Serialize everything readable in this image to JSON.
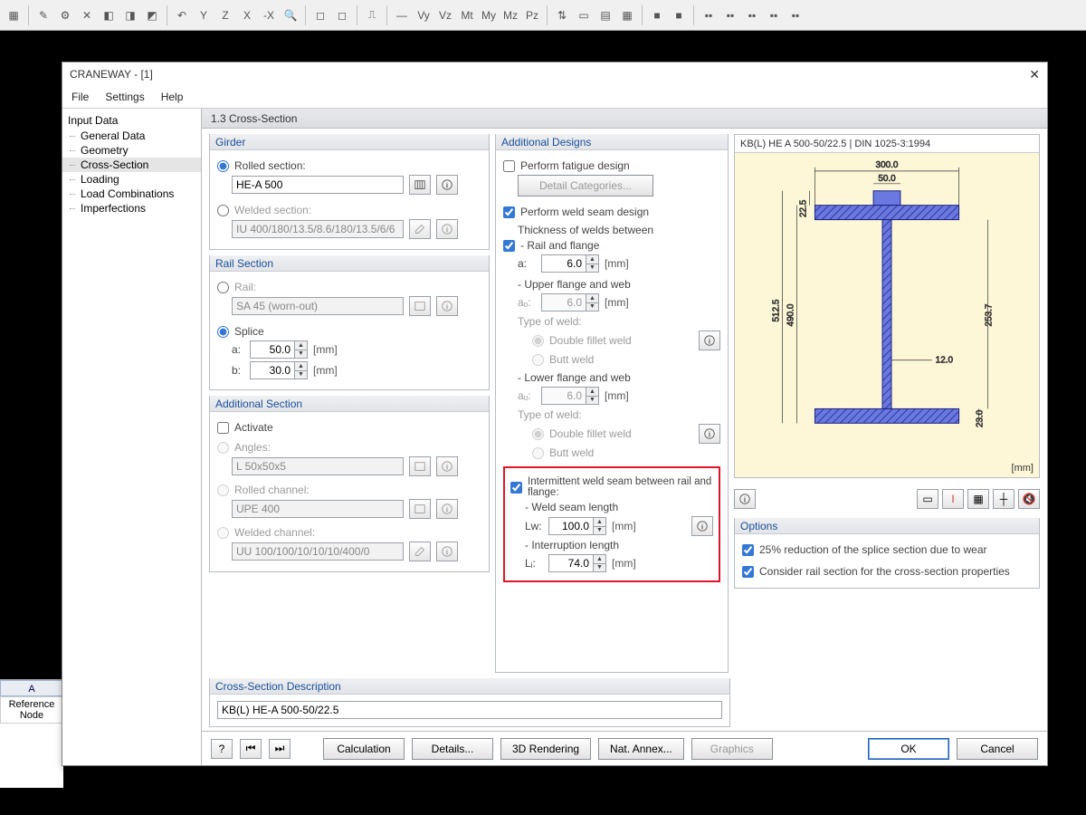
{
  "app": {
    "title": "CRANEWAY - [1]"
  },
  "menubar": {
    "file": "File",
    "settings": "Settings",
    "help": "Help"
  },
  "sidebar": {
    "root": "Input Data",
    "items": [
      "General Data",
      "Geometry",
      "Cross-Section",
      "Loading",
      "Load Combinations",
      "Imperfections"
    ],
    "selected": 2
  },
  "mainHeader": "1.3 Cross-Section",
  "girder": {
    "title": "Girder",
    "rolled_label": "Rolled section:",
    "rolled_value": "HE-A 500",
    "welded_label": "Welded section:",
    "welded_value": "IU 400/180/13.5/8.6/180/13.5/6/6"
  },
  "rail": {
    "title": "Rail Section",
    "rail_label": "Rail:",
    "rail_value": "SA 45 (worn-out)",
    "splice_label": "Splice",
    "a_label": "a:",
    "a_value": "50.0",
    "b_label": "b:",
    "b_value": "30.0",
    "unit": "[mm]"
  },
  "additional": {
    "title": "Additional Section",
    "activate": "Activate",
    "angles_label": "Angles:",
    "angles_value": "L 50x50x5",
    "rolled_channel_label": "Rolled channel:",
    "rolled_channel_value": "UPE 400",
    "welded_channel_label": "Welded channel:",
    "welded_channel_value": "UU 100/100/10/10/10/400/0"
  },
  "designs": {
    "title": "Additional Designs",
    "fatigue": "Perform fatigue design",
    "detail_btn": "Detail Categories...",
    "seam": "Perform weld seam design",
    "thickness_header": "Thickness of welds between",
    "rail_flange": "- Rail and flange",
    "a_label": "a:",
    "a_value": "6.0",
    "unit": "[mm]",
    "upper_flange": "- Upper flange and web",
    "ao_label": "aₒ:",
    "ao_value": "6.0",
    "type_label": "Type of weld:",
    "double_fillet": "Double fillet weld",
    "butt": "Butt weld",
    "lower_flange": "- Lower flange and web",
    "au_label": "aᵤ:",
    "au_value": "6.0",
    "intermittent": "Intermittent weld seam between rail and flange:",
    "weld_len_label": "- Weld seam length",
    "lw_label": "Lw:",
    "lw_value": "100.0",
    "interruption_label": "- Interruption length",
    "li_label": "Lᵢ:",
    "li_value": "74.0"
  },
  "preview": {
    "header": "KB(L) HE A 500-50/22.5 | DIN 1025-3:1994",
    "dims": {
      "top_w": "300.0",
      "rail_w": "50.0",
      "rail_h": "22.5",
      "web_h": "253.7",
      "h_total": "512.5",
      "h_inner": "490.0",
      "tw": "12.0",
      "tf": "23.0"
    },
    "unit": "[mm]"
  },
  "options": {
    "title": "Options",
    "reduction": "25% reduction of the splice section due to wear",
    "consider": "Consider rail section for the cross-section properties"
  },
  "desc": {
    "title": "Cross-Section Description",
    "value": "KB(L) HE-A 500-50/22.5"
  },
  "buttons": {
    "calc": "Calculation",
    "details": "Details...",
    "render": "3D Rendering",
    "annex": "Nat. Annex...",
    "graphics": "Graphics",
    "ok": "OK",
    "cancel": "Cancel"
  },
  "sheet": {
    "col": "A",
    "row1": "Reference",
    "row2": "Node"
  }
}
